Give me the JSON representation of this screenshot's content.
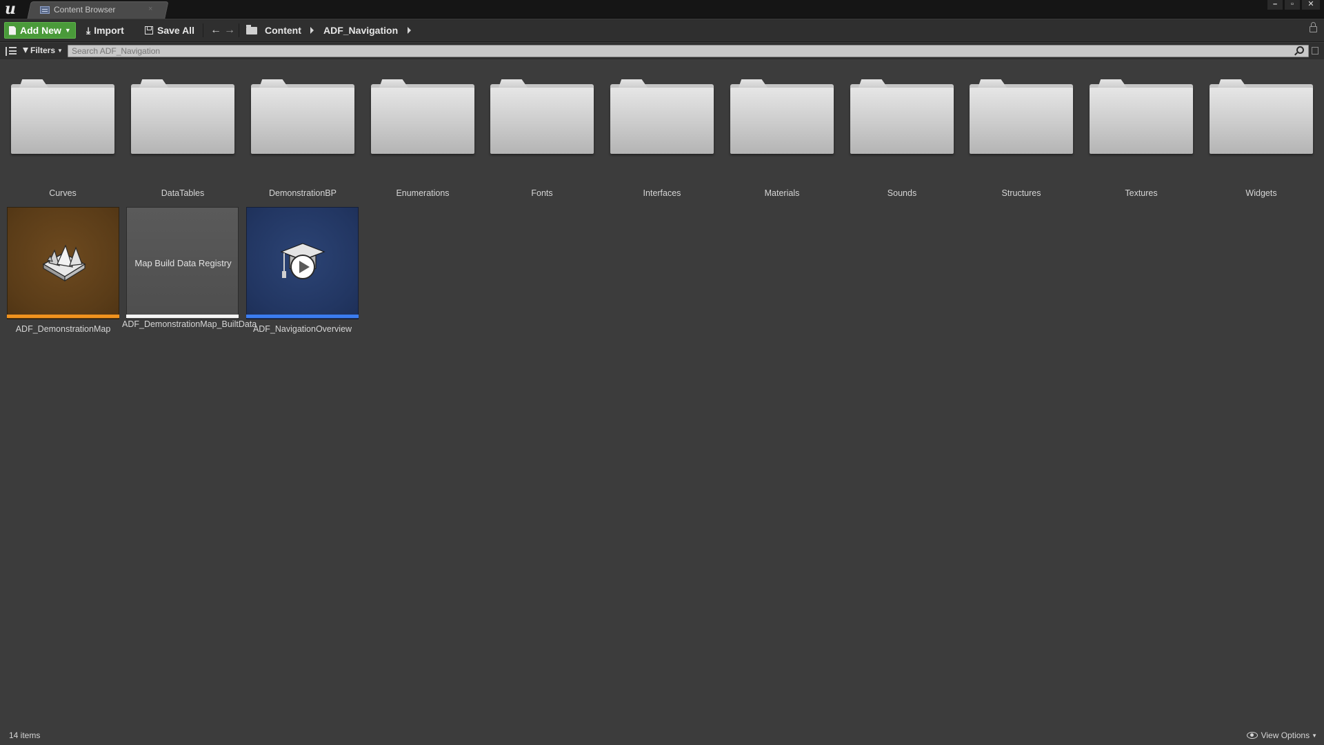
{
  "tab": {
    "title": "Content Browser",
    "close": "×"
  },
  "window": {
    "minimize": "–",
    "restore": "▫",
    "close": "✕"
  },
  "toolbar": {
    "add_new": "Add New",
    "import": "Import",
    "save_all": "Save All",
    "breadcrumb": [
      "Content",
      "ADF_Navigation"
    ]
  },
  "filterbar": {
    "filters": "Filters",
    "search_placeholder": "Search ADF_Navigation"
  },
  "folders": [
    {
      "name": "Curves"
    },
    {
      "name": "DataTables"
    },
    {
      "name": "DemonstrationBP"
    },
    {
      "name": "Enumerations"
    },
    {
      "name": "Fonts"
    },
    {
      "name": "Interfaces"
    },
    {
      "name": "Materials"
    },
    {
      "name": "Sounds"
    },
    {
      "name": "Structures"
    },
    {
      "name": "Textures"
    },
    {
      "name": "Widgets"
    }
  ],
  "assets": [
    {
      "name": "ADF_DemonstrationMap",
      "kind": "level",
      "bar_color": "#f0921e",
      "icon": "level-map-icon"
    },
    {
      "name": "ADF_DemonstrationMap_BuiltData",
      "kind": "map-build-data",
      "thumb_text": "Map Build Data Registry",
      "bar_color": "#f4f4f4"
    },
    {
      "name": "ADF_NavigationOverview",
      "kind": "tutorial",
      "bar_color": "#3b7cf0",
      "icon": "tutorial-play-icon"
    }
  ],
  "status": {
    "items_count": "14 items",
    "view_options": "View Options"
  },
  "colors": {
    "accent_green": "#4a9a3a",
    "background": "#3c3c3c",
    "toolbar": "#2f2f2f"
  }
}
